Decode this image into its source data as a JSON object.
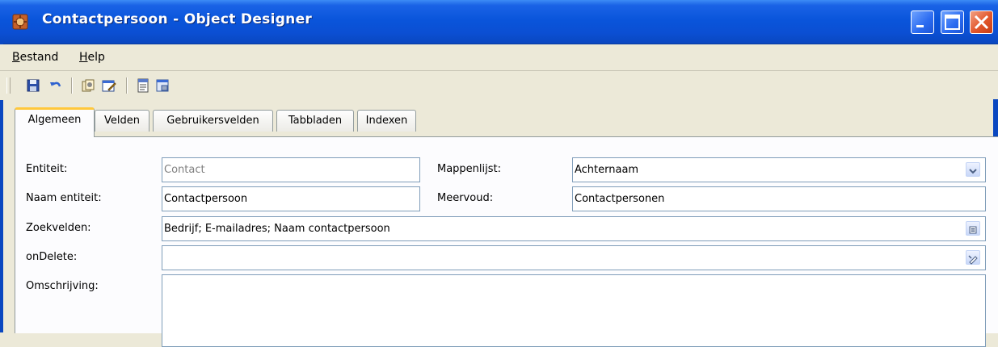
{
  "window": {
    "title": "Contactpersoon - Object Designer"
  },
  "menu": {
    "items": [
      {
        "label_ul": "B",
        "label_rest": "estand"
      },
      {
        "label_ul": "H",
        "label_rest": "elp"
      }
    ]
  },
  "toolbar": {
    "icons": [
      "save-icon",
      "undo-icon",
      "copy-object-icon",
      "edit-object-icon",
      "properties-icon",
      "print-preview-icon"
    ]
  },
  "tabs": [
    {
      "label": "Algemeen",
      "active": true
    },
    {
      "label": "Velden"
    },
    {
      "label": "Gebruikersvelden"
    },
    {
      "label": "Tabbladen"
    },
    {
      "label": "Indexen"
    }
  ],
  "form": {
    "entity": {
      "label": "Entiteit:",
      "value": "Contact"
    },
    "folderlist": {
      "label": "Mappenlijst:",
      "value": "Achternaam"
    },
    "entity_name": {
      "label": "Naam entiteit:",
      "value": "Contactpersoon"
    },
    "plural": {
      "label": "Meervoud:",
      "value": "Contactpersonen"
    },
    "searchfields": {
      "label": "Zoekvelden:",
      "value": "Bedrijf; E-mailadres; Naam contactpersoon"
    },
    "ondelete": {
      "label": "onDelete:",
      "value": ""
    },
    "description": {
      "label": "Omschrijving:",
      "value": ""
    }
  },
  "colors": {
    "titlebar": "#0a55db",
    "active_tab_accent": "#ffc83c",
    "field_border": "#7f9db9"
  }
}
